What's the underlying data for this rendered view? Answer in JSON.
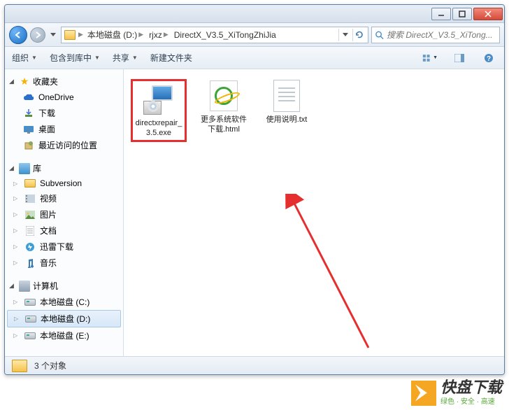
{
  "address": {
    "crumbs": [
      "本地磁盘 (D:)",
      "rjxz",
      "DirectX_V3.5_XiTongZhiJia"
    ]
  },
  "search": {
    "placeholder": "搜索 DirectX_V3.5_XiTong..."
  },
  "toolbar": {
    "organize": "组织",
    "include": "包含到库中",
    "share": "共享",
    "newfolder": "新建文件夹"
  },
  "sidebar": {
    "favorites": {
      "label": "收藏夹",
      "items": [
        "OneDrive",
        "下载",
        "桌面",
        "最近访问的位置"
      ]
    },
    "libraries": {
      "label": "库",
      "items": [
        "Subversion",
        "视频",
        "图片",
        "文档",
        "迅雷下载",
        "音乐"
      ]
    },
    "computer": {
      "label": "计算机",
      "items": [
        "本地磁盘 (C:)",
        "本地磁盘 (D:)",
        "本地磁盘 (E:)"
      ],
      "selectedIndex": 1
    }
  },
  "files": [
    {
      "name": "directxrepair_3.5.exe",
      "type": "exe",
      "highlight": true
    },
    {
      "name": "更多系统软件下载.html",
      "type": "html",
      "highlight": false
    },
    {
      "name": "使用说明.txt",
      "type": "txt",
      "highlight": false
    }
  ],
  "status": {
    "count": "3 个对象"
  },
  "watermark": {
    "brand": "快盘下载",
    "tagline": "绿色 · 安全 · 高速"
  }
}
